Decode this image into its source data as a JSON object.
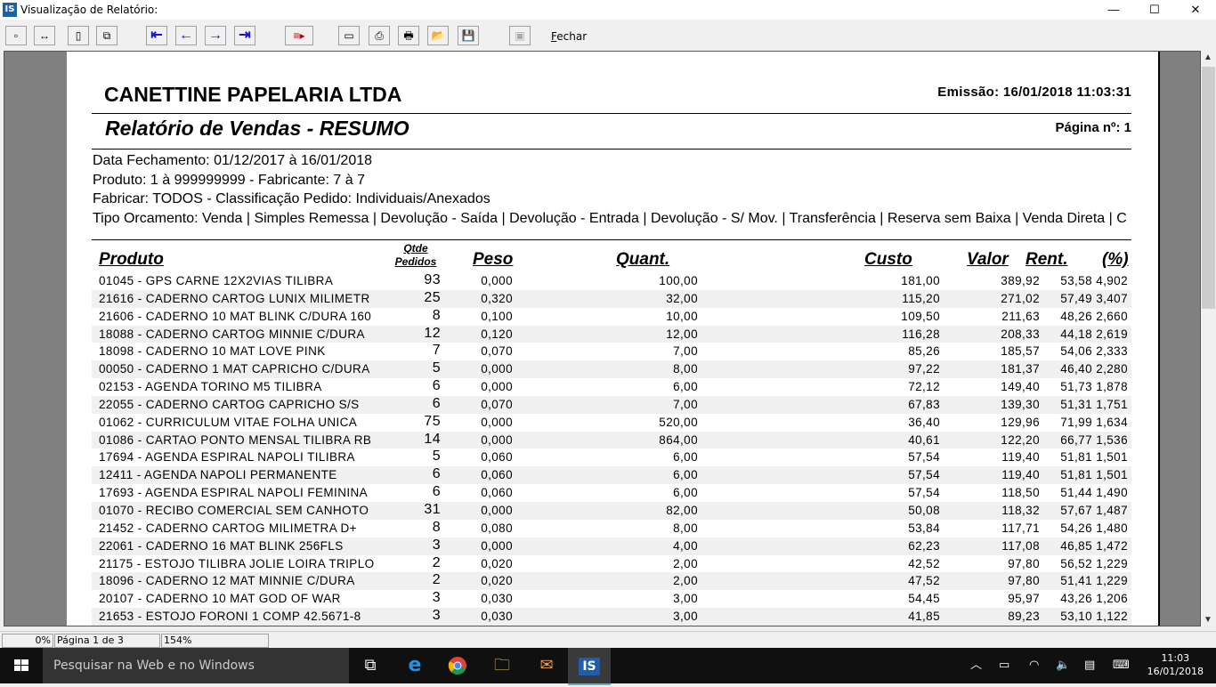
{
  "window": {
    "title": "Visualização de Relatório:",
    "minimize": "—",
    "maximize": "☐",
    "close": "✕"
  },
  "toolbar": {
    "fechar_first": "F",
    "fechar_rest": "echar"
  },
  "report": {
    "company": "CANETTINE PAPELARIA LTDA",
    "emissao": "Emissão: 16/01/2018 11:03:31",
    "title": "Relatório de Vendas - RESUMO",
    "pagina": "Página nº: 1",
    "filters": [
      "Data Fechamento: 01/12/2017 à 16/01/2018",
      "Produto: 1 à 999999999 - Fabricante: 7 à 7",
      "Fabricar: TODOS - Classificação Pedido: Individuais/Anexados",
      "Tipo Orcamento: Venda | Simples Remessa | Devolução - Saída | Devolução - Entrada | Devolução - S/ Mov. | Transferência | Reserva sem Baixa | Venda Direta | C"
    ],
    "columns": {
      "produto": "Produto",
      "qtde": "Qtde",
      "pedidos": "Pedidos",
      "peso": "Peso",
      "quant": "Quant.",
      "custo": "Custo",
      "valor": "Valor",
      "rent": "Rent.",
      "pct": "(%)"
    },
    "rows": [
      [
        "01045 - GPS CARNE 12X2VIAS TILIBRA",
        "93",
        "0,000",
        "100,00",
        "181,00",
        "389,92",
        "53,58",
        "4,902"
      ],
      [
        "21616 - CADERNO CARTOG LUNIX MILIMETR",
        "25",
        "0,320",
        "32,00",
        "115,20",
        "271,02",
        "57,49",
        "3,407"
      ],
      [
        "21606 - CADERNO 10 MAT BLINK C/DURA 160",
        "8",
        "0,100",
        "10,00",
        "109,50",
        "211,63",
        "48,26",
        "2,660"
      ],
      [
        "18088 - CADERNO CARTOG MINNIE C/DURA",
        "12",
        "0,120",
        "12,00",
        "116,28",
        "208,33",
        "44,18",
        "2,619"
      ],
      [
        "18098 - CADERNO 10 MAT LOVE PINK",
        "7",
        "0,070",
        "7,00",
        "85,26",
        "185,57",
        "54,06",
        "2,333"
      ],
      [
        "00050 - CADERNO 1 MAT CAPRICHO C/DURA",
        "5",
        "0,000",
        "8,00",
        "97,22",
        "181,37",
        "46,40",
        "2,280"
      ],
      [
        "02153 - AGENDA TORINO M5 TILIBRA",
        "6",
        "0,000",
        "6,00",
        "72,12",
        "149,40",
        "51,73",
        "1,878"
      ],
      [
        "22055 - CADERNO CARTOG CAPRICHO S/S",
        "6",
        "0,070",
        "7,00",
        "67,83",
        "139,30",
        "51,31",
        "1,751"
      ],
      [
        "01062 - CURRICULUM VITAE FOLHA UNICA",
        "75",
        "0,000",
        "520,00",
        "36,40",
        "129,96",
        "71,99",
        "1,634"
      ],
      [
        "01086 - CARTAO PONTO MENSAL TILIBRA RB",
        "14",
        "0,000",
        "864,00",
        "40,61",
        "122,20",
        "66,77",
        "1,536"
      ],
      [
        "17694 - AGENDA ESPIRAL NAPOLI TILIBRA",
        "5",
        "0,060",
        "6,00",
        "57,54",
        "119,40",
        "51,81",
        "1,501"
      ],
      [
        "12411 - AGENDA NAPOLI PERMANENTE",
        "6",
        "0,060",
        "6,00",
        "57,54",
        "119,40",
        "51,81",
        "1,501"
      ],
      [
        "17693 - AGENDA ESPIRAL NAPOLI FEMININA",
        "6",
        "0,060",
        "6,00",
        "57,54",
        "118,50",
        "51,44",
        "1,490"
      ],
      [
        "01070 - RECIBO COMERCIAL SEM CANHOTO",
        "31",
        "0,000",
        "82,00",
        "50,08",
        "118,32",
        "57,67",
        "1,487"
      ],
      [
        "21452 - CADERNO CARTOG  MILIMETRA D+",
        "8",
        "0,080",
        "8,00",
        "53,84",
        "117,71",
        "54,26",
        "1,480"
      ],
      [
        "22061 - CADERNO 16 MAT BLINK 256FLS",
        "3",
        "0,000",
        "4,00",
        "62,23",
        "117,08",
        "46,85",
        "1,472"
      ],
      [
        "21175 - ESTOJO TILIBRA JOLIE LOIRA TRIPLO",
        "2",
        "0,020",
        "2,00",
        "42,52",
        "97,80",
        "56,52",
        "1,229"
      ],
      [
        "18096 - CADERNO 12 MAT MINNIE C/DURA",
        "2",
        "0,020",
        "2,00",
        "47,52",
        "97,80",
        "51,41",
        "1,229"
      ],
      [
        "20107 - CADERNO 10 MAT GOD OF WAR",
        "3",
        "0,030",
        "3,00",
        "54,45",
        "95,97",
        "43,26",
        "1,206"
      ],
      [
        "21653 - ESTOJO FORONI 1 COMP 42.5671-8",
        "3",
        "0,030",
        "3,00",
        "41,85",
        "89,23",
        "53,10",
        "1,122"
      ]
    ]
  },
  "statusbar": {
    "progress": "0%",
    "page": "Página 1 de 3",
    "zoom": "154%"
  },
  "taskbar": {
    "search_placeholder": "Pesquisar na Web e no Windows",
    "time": "11:03",
    "date": "16/01/2018",
    "app_label": "IS"
  }
}
